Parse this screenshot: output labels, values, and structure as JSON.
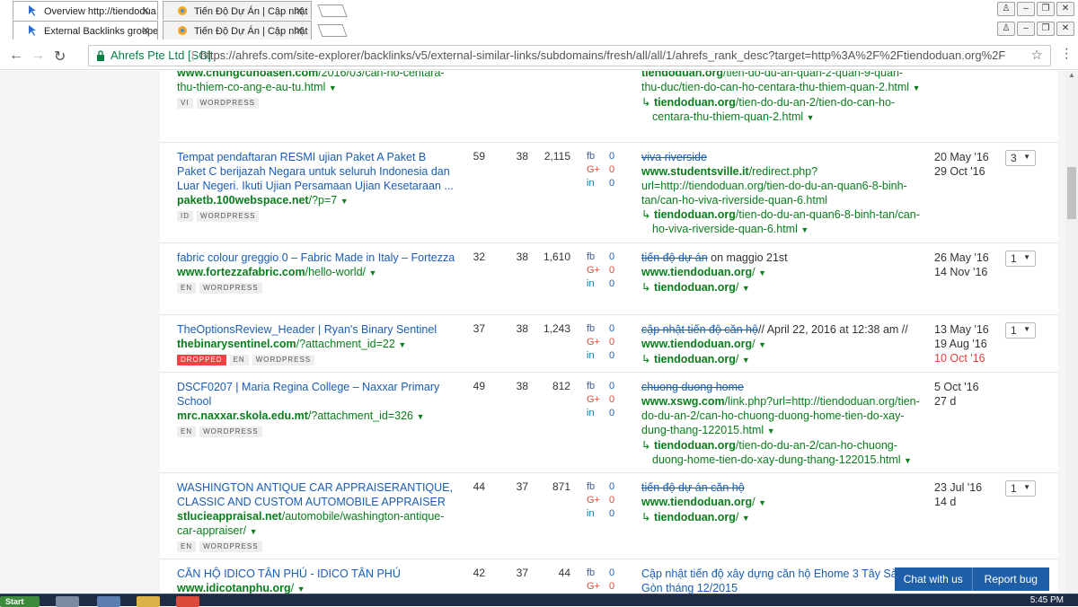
{
  "browser": {
    "tabs_row1": [
      {
        "title": "Overview http://tiendodua",
        "active": true
      },
      {
        "title": "Tiến Độ Dự Án | Cập nhật t",
        "active": false
      }
    ],
    "tabs_row2": [
      {
        "title": "External Backlinks grouped",
        "active": true
      },
      {
        "title": "Tiến Độ Dự Án | Cập nhật t",
        "active": false
      }
    ],
    "secure_label": "Ahrefs Pte Ltd [SG]",
    "url": "https://ahrefs.com/site-explorer/backlinks/v5/external-similar-links/subdomains/fresh/all/all/1/ahrefs_rank_desc?target=http%3A%2F%2Ftiendoduan.org%2F"
  },
  "rows": [
    {
      "title_lines": [],
      "domain": "www.chungcunoasen.com",
      "path": "/2016/03/can-ho-centara-thu-thiem-co-ang-e-au-tu.html",
      "tags": [
        "VI",
        "WORDPRESS"
      ],
      "anchor_text": "",
      "anchor_rest": "",
      "ref_domain": "tiendoduan.org",
      "ref_path": "/tien-do-du-an-quan-2-quan-9-quan-thu-duc/tien-do-can-ho-centara-thu-thiem-quan-2.html",
      "target_domain": "tiendoduan.org",
      "target_path": "/tien-do-du-an-2/tien-do-can-ho-centara-thu-thiem-quan-2.html"
    },
    {
      "title": "Tempat pendaftaran RESMI ujian Paket A Paket B Paket C berijazah Negara untuk seluruh Indonesia dan Luar Negeri. Ikuti Ujian Persamaan Ujian Kesetaraan ...",
      "domain": "paketb.100webspace.net",
      "path": "/?p=7",
      "tags": [
        "ID",
        "WORDPRESS"
      ],
      "dr": "59",
      "ur": "38",
      "ext": "2,115",
      "fb": "0",
      "gp": "0",
      "in": "0",
      "anchor_text": "viva riverside",
      "anchor_rest": "",
      "ref_domain": "www.studentsville.it",
      "ref_path": "/redirect.php?url=http://tiendoduan.org/tien-do-du-an-quan6-8-binh-tan/can-ho-viva-riverside-quan-6.html",
      "target_domain": "tiendoduan.org",
      "target_path": "/tien-do-du-an-quan6-8-binh-tan/can-ho-viva-riverside-quan-6.html",
      "first_seen": "20 May '16",
      "last_seen": "29 Oct '16",
      "links": "3"
    },
    {
      "title": "fabric colour greggio 0 – Fabric Made in Italy – Fortezza",
      "domain": "www.fortezzafabric.com",
      "path": "/hello-world/",
      "tags": [
        "EN",
        "WORDPRESS"
      ],
      "dr": "32",
      "ur": "38",
      "ext": "1,610",
      "fb": "0",
      "gp": "0",
      "in": "0",
      "anchor_text": "tiến độ dự án",
      "anchor_rest": " on maggio 21st",
      "ref_domain": "www.tiendoduan.org",
      "ref_path": "/",
      "target_domain": "tiendoduan.org",
      "target_path": "/",
      "first_seen": "26 May '16",
      "last_seen": "14 Nov '16",
      "links": "1"
    },
    {
      "title": "TheOptionsReview_Header | Ryan's Binary Sentinel",
      "domain": "thebinarysentinel.com",
      "path": "/?attachment_id=22",
      "tags": [
        "DROPPED",
        "EN",
        "WORDPRESS"
      ],
      "dr": "37",
      "ur": "38",
      "ext": "1,243",
      "fb": "0",
      "gp": "0",
      "in": "0",
      "anchor_text": "cập nhật tiến độ căn hộ",
      "anchor_rest": "// April 22, 2016 at 12:38 am //",
      "ref_domain": "www.tiendoduan.org",
      "ref_path": "/",
      "target_domain": "tiendoduan.org",
      "target_path": "/",
      "first_seen": "13 May '16",
      "last_seen": "19 Aug '16",
      "lost": "10 Oct '16",
      "links": "1"
    },
    {
      "title": "DSCF0207 | Maria Regina College – Naxxar Primary School",
      "domain": "mrc.naxxar.skola.edu.mt",
      "path": "/?attachment_id=326",
      "tags": [
        "EN",
        "WORDPRESS"
      ],
      "dr": "49",
      "ur": "38",
      "ext": "812",
      "fb": "0",
      "gp": "0",
      "in": "0",
      "anchor_text": "chuong duong home",
      "anchor_rest": "",
      "ref_domain": "www.xswg.com",
      "ref_path": "/link.php?url=http://tiendoduan.org/tien-do-du-an-2/can-ho-chuong-duong-home-tien-do-xay-dung-thang-122015.html",
      "target_domain": "tiendoduan.org",
      "target_path": "/tien-do-du-an-2/can-ho-chuong-duong-home-tien-do-xay-dung-thang-122015.html",
      "first_seen": "5 Oct '16",
      "last_seen": "27 d"
    },
    {
      "title": "WASHINGTON ANTIQUE CAR APPRAISERANTIQUE, CLASSIC AND CUSTOM AUTOMOBILE APPRAISER",
      "domain": "stlucieappraisal.net",
      "path": "/automobile/washington-antique-car-appraiser/",
      "tags": [
        "EN",
        "WORDPRESS"
      ],
      "dr": "44",
      "ur": "37",
      "ext": "871",
      "fb": "0",
      "gp": "0",
      "in": "0",
      "anchor_text": "tiến độ dự án căn hộ",
      "anchor_rest": "",
      "ref_domain": "www.tiendoduan.org",
      "ref_path": "/",
      "target_domain": "tiendoduan.org",
      "target_path": "/",
      "first_seen": "23 Jul '16",
      "last_seen": "14 d",
      "links": "1"
    },
    {
      "title": "CĂN HỘ IDICO TÂN PHÚ - IDICO TÂN PHÚ",
      "domain": "www.idicotanphu.org",
      "path": "/",
      "dr": "42",
      "ur": "37",
      "ext": "44",
      "fb": "0",
      "gp": "0",
      "in": "",
      "anchor_plain": "Cập nhật tiến độ xây dựng căn hộ Ehome 3 Tây Sài Gòn tháng 12/2015"
    }
  ],
  "chat": {
    "chat_label": "Chat with us",
    "report_label": "Report bug"
  },
  "taskbar": {
    "start_label": "Start",
    "clock": "5:45 PM"
  }
}
